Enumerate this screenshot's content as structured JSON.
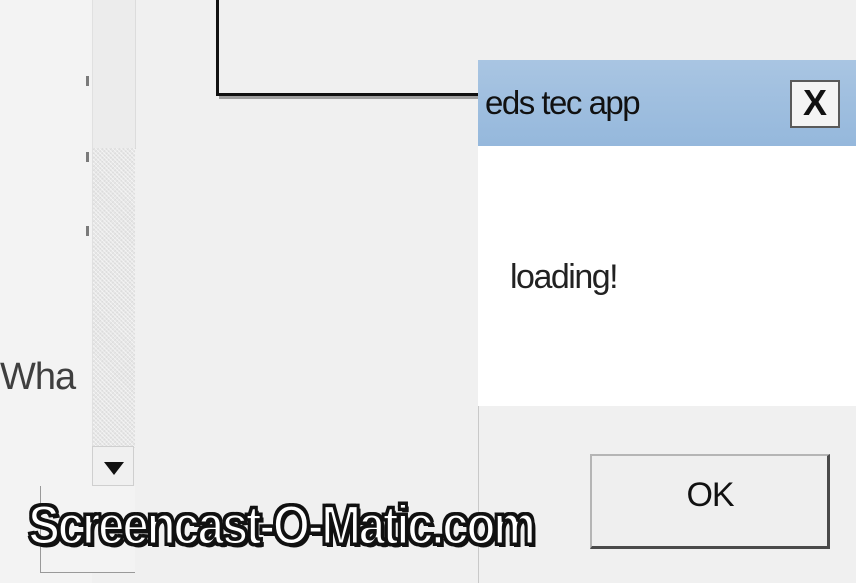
{
  "left_panel": {
    "header_text": "Wha",
    "label_text": "Wha"
  },
  "dialog": {
    "title": "eds tec app",
    "close_label": "X",
    "message": "loading!",
    "ok_label": "OK"
  },
  "watermark": {
    "text": "Screencast-O-Matic.com"
  },
  "colors": {
    "titlebar": "#9dbee0",
    "dialog_body": "#ffffff",
    "background": "#f0f0f0"
  }
}
